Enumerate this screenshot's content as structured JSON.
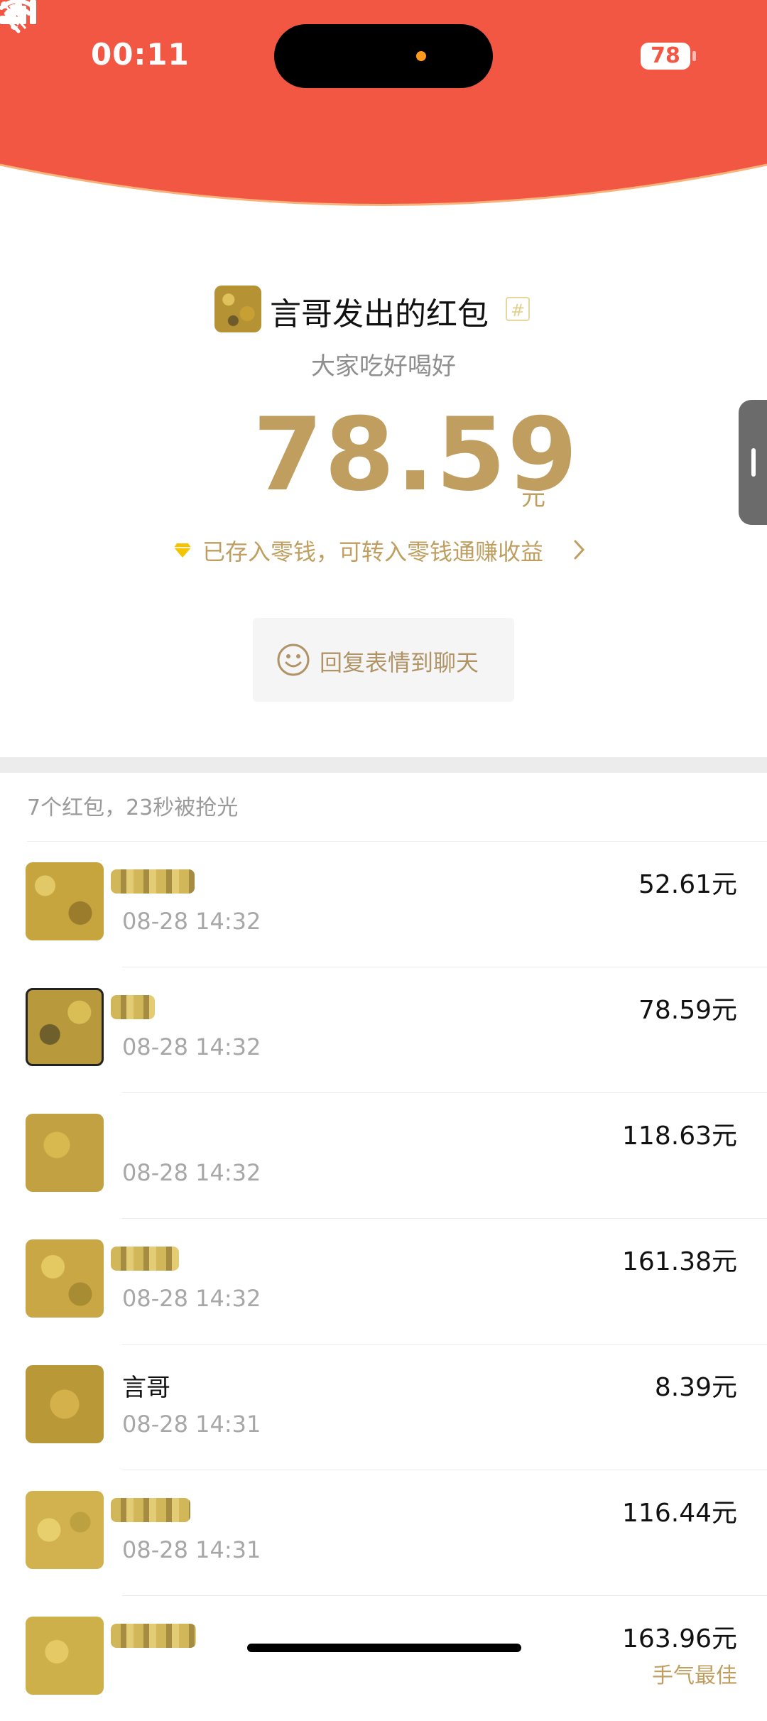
{
  "status_bar": {
    "time": "00:11",
    "battery": "78"
  },
  "header": {
    "back_icon": "chevron-left-icon",
    "more_icon": "more-icon",
    "accent": "#f25744"
  },
  "packet": {
    "sender_title": "言哥发出的红包",
    "tag_icon": "hash-tag-icon",
    "greeting": "大家吃好喝好",
    "amount": "78.59",
    "unit": "元",
    "saved_text": "已存入零钱，可转入零钱通赚收益",
    "reply_label": "回复表情到聊天",
    "amount_color": "#bf9e5f"
  },
  "summary": "7个红包，23秒被抢光",
  "records": [
    {
      "name": "",
      "time": "08-28 14:32",
      "amount": "52.61元"
    },
    {
      "name": "",
      "time": "08-28 14:32",
      "amount": "78.59元"
    },
    {
      "name": "",
      "time": "08-28 14:32",
      "amount": "118.63元"
    },
    {
      "name": "",
      "time": "08-28 14:32",
      "amount": "161.38元"
    },
    {
      "name": "言哥",
      "time": "08-28 14:31",
      "amount": "8.39元"
    },
    {
      "name": "",
      "time": "08-28 14:31",
      "amount": "116.44元"
    },
    {
      "name": "",
      "time": "",
      "amount": "163.96元",
      "tag": "手气最佳"
    }
  ]
}
